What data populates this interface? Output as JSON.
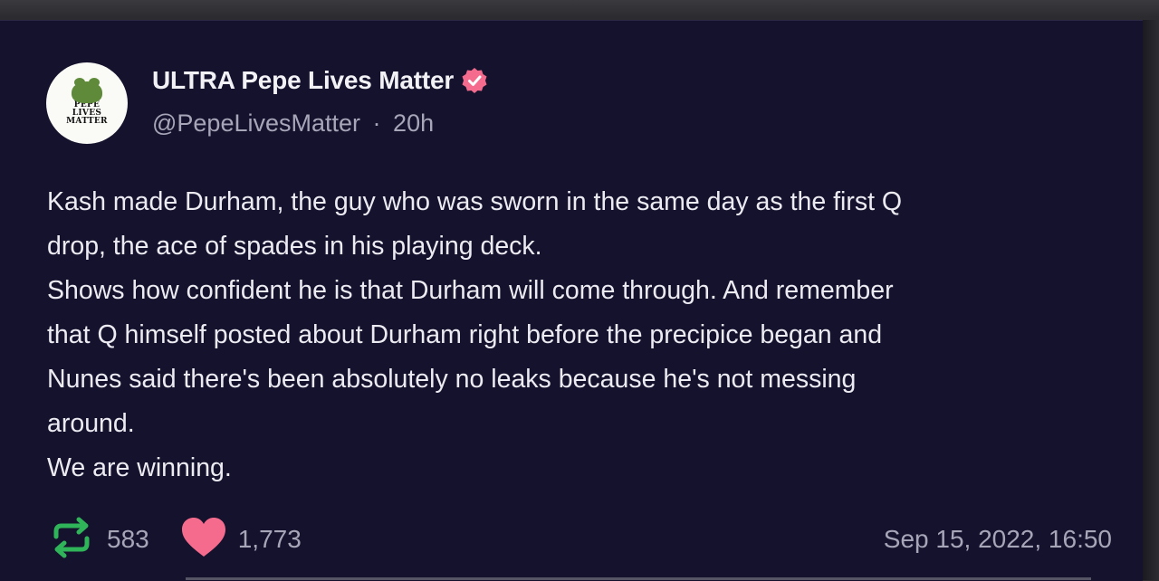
{
  "author": {
    "display_name": "ULTRA Pepe Lives Matter",
    "handle": "@PepeLivesMatter",
    "separator": "·",
    "age": "20h",
    "avatar_text": [
      "PEPE",
      "LIVES",
      "MATTER"
    ],
    "verified_icon": "verified-badge-icon"
  },
  "post": {
    "lines": [
      "Kash made Durham, the guy who was sworn in the same day as the first Q",
      "drop, the ace of spades in his playing deck.",
      "Shows how confident he is that Durham will come through. And remember",
      "that Q himself posted about Durham right before the precipice began and",
      "Nunes said there's been absolutely no leaks because he's not messing",
      "around.",
      "We are winning."
    ]
  },
  "footer": {
    "reposts": "583",
    "likes": "1,773",
    "timestamp": "Sep 15, 2022, 16:50",
    "repost_icon": "repost-icon",
    "like_icon": "heart-icon"
  },
  "colors": {
    "background": "#15122d",
    "text": "#ecebf2",
    "muted": "#a7a5b8",
    "repost": "#2fb45a",
    "like": "#f56b8d",
    "verified": "#f56b8d"
  }
}
